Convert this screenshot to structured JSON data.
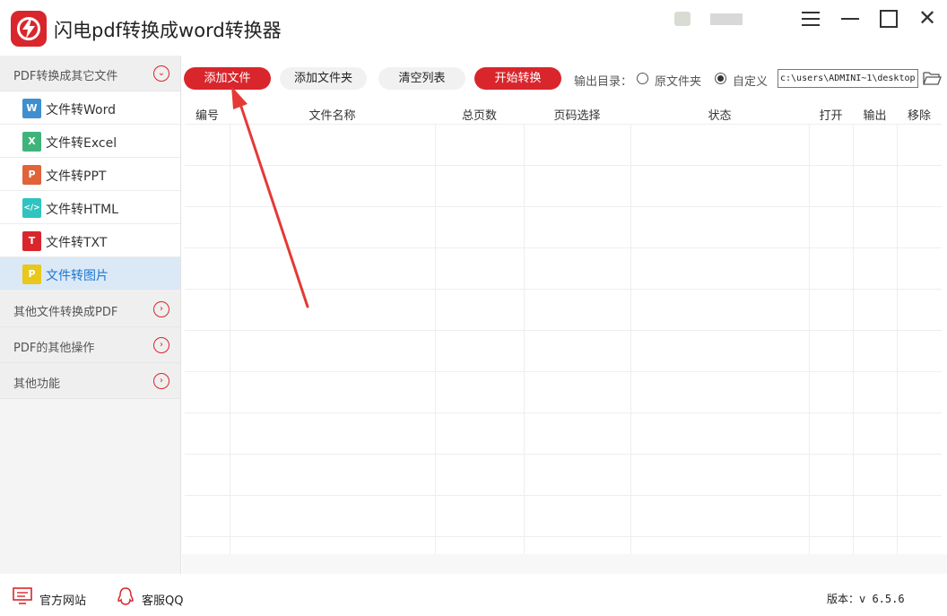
{
  "app": {
    "title": "闪电pdf转换成word转换器",
    "accent_color": "#d8262c"
  },
  "window_controls": {
    "menu_icon": "menu-icon",
    "minimize_icon": "minimize-icon",
    "maximize_icon": "maximize-icon",
    "close_icon": "close-icon",
    "close_glyph": "✕"
  },
  "sidebar": {
    "groups": [
      {
        "label": "PDF转换成其它文件",
        "expanded": true,
        "chevron": "⌄"
      },
      {
        "label": "其他文件转换成PDF",
        "expanded": false,
        "chevron": "›"
      },
      {
        "label": "PDF的其他操作",
        "expanded": false,
        "chevron": "›"
      },
      {
        "label": "其他功能",
        "expanded": false,
        "chevron": "›"
      }
    ],
    "items": [
      {
        "label": "文件转Word",
        "icon": "W",
        "color": "#3f8fd0"
      },
      {
        "label": "文件转Excel",
        "icon": "X",
        "color": "#3fb37a"
      },
      {
        "label": "文件转PPT",
        "icon": "P",
        "color": "#e0633a"
      },
      {
        "label": "文件转HTML",
        "icon": "</>",
        "color": "#2fc4c0"
      },
      {
        "label": "文件转TXT",
        "icon": "T",
        "color": "#d8262c"
      },
      {
        "label": "文件转图片",
        "icon": "P",
        "color": "#e8c81a",
        "active": true
      }
    ]
  },
  "toolbar": {
    "add_file": "添加文件",
    "add_folder": "添加文件夹",
    "clear_list": "清空列表",
    "start_convert": "开始转换",
    "output_dir_label": "输出目录：",
    "option_original": "原文件夹",
    "option_custom": "自定义",
    "selected_option": "自定义",
    "path_value": "c:\\users\\ADMINI~1\\desktop"
  },
  "table": {
    "columns": [
      "编号",
      "文件名称",
      "总页数",
      "页码选择",
      "状态",
      "打开",
      "输出",
      "移除"
    ],
    "rows": []
  },
  "footer": {
    "website": "官方网站",
    "support": "客服QQ",
    "version": "版本：v 6.5.6"
  }
}
